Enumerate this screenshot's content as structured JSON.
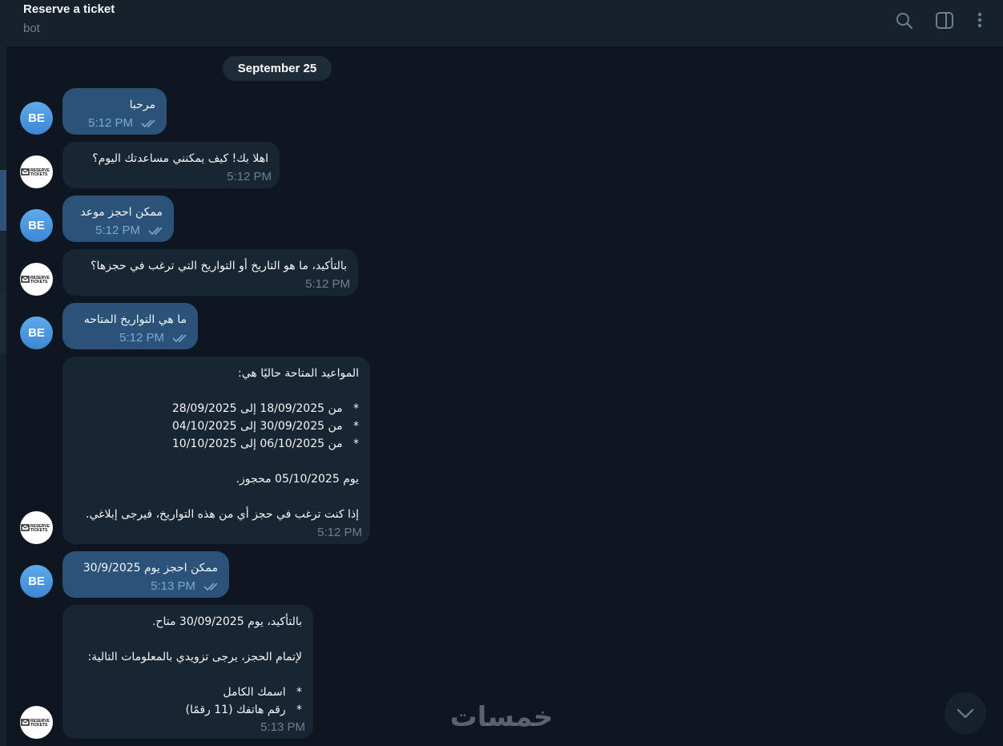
{
  "header": {
    "title": "Reserve a ticket",
    "subtitle": "bot",
    "icons": [
      "search-icon",
      "sidebar-toggle-icon",
      "more-vertical-icon"
    ]
  },
  "date_separator": "September 25",
  "avatars": {
    "user_initials": "BE",
    "bot_logo_line1": "RESERVE",
    "bot_logo_line2": "TICKETS"
  },
  "messages": [
    {
      "from": "user",
      "text": "مرحبا",
      "time": "5:12 PM",
      "read": true
    },
    {
      "from": "bot",
      "text": "اهلا بك! كيف يمكنني مساعدتك اليوم؟",
      "time": "5:12 PM"
    },
    {
      "from": "user",
      "text": "ممكن احجز موعد",
      "time": "5:12 PM",
      "read": true
    },
    {
      "from": "bot",
      "text": "بالتأكيد، ما هو التاريخ أو التواريخ التي ترغب في حجزها؟",
      "time": "5:12 PM"
    },
    {
      "from": "user",
      "text": "ما هي التواريخ المتاحه",
      "time": "5:12 PM",
      "read": true
    },
    {
      "from": "bot",
      "text": "المواعيد المتاحة حاليًا هي:\n\n*   من 18/09/2025 إلى 28/09/2025\n*   من 30/09/2025 إلى 04/10/2025\n*   من 06/10/2025 إلى 10/10/2025\n\nيوم 05/10/2025 محجوز.\n\nإذا كنت ترغب في حجز أي من هذه التواريخ، فيرجى إبلاغي.",
      "time": "5:12 PM"
    },
    {
      "from": "user",
      "text": "ممكن احجز يوم 30/9/2025",
      "time": "5:13 PM",
      "read": true
    },
    {
      "from": "bot",
      "text": "بالتأكيد، يوم 30/09/2025 متاح.\n\nلإتمام الحجز، يرجى تزويدي بالمعلومات التالية:\n\n*   اسمك الكامل\n*   رقم هاتفك (11 رقمًا)",
      "time": "5:13 PM"
    }
  ],
  "scroll_button": "chevron-down-icon",
  "watermark": "خمسات",
  "colors": {
    "background": "#0e1621",
    "header": "#17212b",
    "outgoing_bubble": "#2b5278",
    "incoming_bubble": "#182533",
    "date_pill": "#1e2c3a",
    "read_ticks": "#7da8d3",
    "incoming_time": "#6d7f8f"
  }
}
